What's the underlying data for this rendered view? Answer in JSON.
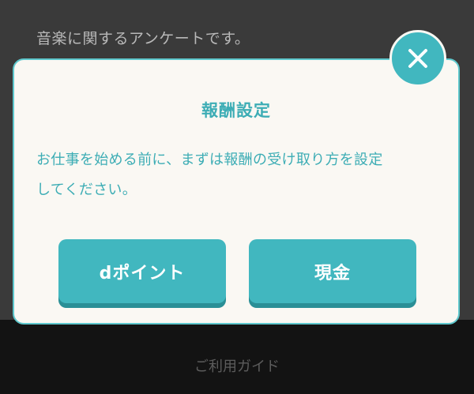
{
  "background": {
    "survey_text": "音楽に関するアンケートです。",
    "footer_link": "ご利用ガイド"
  },
  "modal": {
    "title": "報酬設定",
    "message_line1": "お仕事を始める前に、まずは報酬の受け取り方を設定",
    "message_line2": "してください。",
    "buttons": {
      "dpoint": "dポイント",
      "cash": "現金"
    },
    "close_icon": "close-icon"
  },
  "colors": {
    "accent": "#41b7bf",
    "accent_dark": "#2a8f96",
    "modal_bg": "#faf8f3",
    "overlay": "#3a3a3a"
  }
}
